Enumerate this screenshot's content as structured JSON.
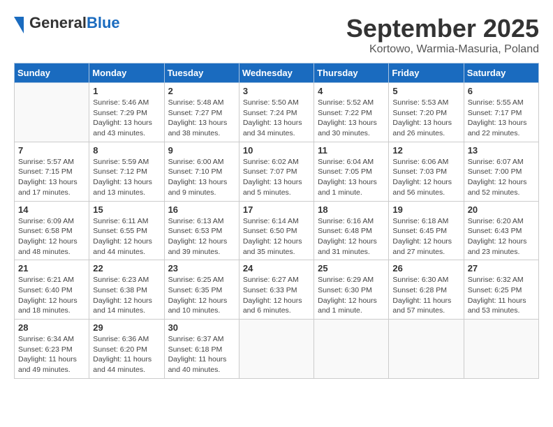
{
  "header": {
    "logo_general": "General",
    "logo_blue": "Blue",
    "month_title": "September 2025",
    "location": "Kortowo, Warmia-Masuria, Poland"
  },
  "days_of_week": [
    "Sunday",
    "Monday",
    "Tuesday",
    "Wednesday",
    "Thursday",
    "Friday",
    "Saturday"
  ],
  "weeks": [
    [
      {
        "day": "",
        "info": ""
      },
      {
        "day": "1",
        "info": "Sunrise: 5:46 AM\nSunset: 7:29 PM\nDaylight: 13 hours\nand 43 minutes."
      },
      {
        "day": "2",
        "info": "Sunrise: 5:48 AM\nSunset: 7:27 PM\nDaylight: 13 hours\nand 38 minutes."
      },
      {
        "day": "3",
        "info": "Sunrise: 5:50 AM\nSunset: 7:24 PM\nDaylight: 13 hours\nand 34 minutes."
      },
      {
        "day": "4",
        "info": "Sunrise: 5:52 AM\nSunset: 7:22 PM\nDaylight: 13 hours\nand 30 minutes."
      },
      {
        "day": "5",
        "info": "Sunrise: 5:53 AM\nSunset: 7:20 PM\nDaylight: 13 hours\nand 26 minutes."
      },
      {
        "day": "6",
        "info": "Sunrise: 5:55 AM\nSunset: 7:17 PM\nDaylight: 13 hours\nand 22 minutes."
      }
    ],
    [
      {
        "day": "7",
        "info": "Sunrise: 5:57 AM\nSunset: 7:15 PM\nDaylight: 13 hours\nand 17 minutes."
      },
      {
        "day": "8",
        "info": "Sunrise: 5:59 AM\nSunset: 7:12 PM\nDaylight: 13 hours\nand 13 minutes."
      },
      {
        "day": "9",
        "info": "Sunrise: 6:00 AM\nSunset: 7:10 PM\nDaylight: 13 hours\nand 9 minutes."
      },
      {
        "day": "10",
        "info": "Sunrise: 6:02 AM\nSunset: 7:07 PM\nDaylight: 13 hours\nand 5 minutes."
      },
      {
        "day": "11",
        "info": "Sunrise: 6:04 AM\nSunset: 7:05 PM\nDaylight: 13 hours\nand 1 minute."
      },
      {
        "day": "12",
        "info": "Sunrise: 6:06 AM\nSunset: 7:03 PM\nDaylight: 12 hours\nand 56 minutes."
      },
      {
        "day": "13",
        "info": "Sunrise: 6:07 AM\nSunset: 7:00 PM\nDaylight: 12 hours\nand 52 minutes."
      }
    ],
    [
      {
        "day": "14",
        "info": "Sunrise: 6:09 AM\nSunset: 6:58 PM\nDaylight: 12 hours\nand 48 minutes."
      },
      {
        "day": "15",
        "info": "Sunrise: 6:11 AM\nSunset: 6:55 PM\nDaylight: 12 hours\nand 44 minutes."
      },
      {
        "day": "16",
        "info": "Sunrise: 6:13 AM\nSunset: 6:53 PM\nDaylight: 12 hours\nand 39 minutes."
      },
      {
        "day": "17",
        "info": "Sunrise: 6:14 AM\nSunset: 6:50 PM\nDaylight: 12 hours\nand 35 minutes."
      },
      {
        "day": "18",
        "info": "Sunrise: 6:16 AM\nSunset: 6:48 PM\nDaylight: 12 hours\nand 31 minutes."
      },
      {
        "day": "19",
        "info": "Sunrise: 6:18 AM\nSunset: 6:45 PM\nDaylight: 12 hours\nand 27 minutes."
      },
      {
        "day": "20",
        "info": "Sunrise: 6:20 AM\nSunset: 6:43 PM\nDaylight: 12 hours\nand 23 minutes."
      }
    ],
    [
      {
        "day": "21",
        "info": "Sunrise: 6:21 AM\nSunset: 6:40 PM\nDaylight: 12 hours\nand 18 minutes."
      },
      {
        "day": "22",
        "info": "Sunrise: 6:23 AM\nSunset: 6:38 PM\nDaylight: 12 hours\nand 14 minutes."
      },
      {
        "day": "23",
        "info": "Sunrise: 6:25 AM\nSunset: 6:35 PM\nDaylight: 12 hours\nand 10 minutes."
      },
      {
        "day": "24",
        "info": "Sunrise: 6:27 AM\nSunset: 6:33 PM\nDaylight: 12 hours\nand 6 minutes."
      },
      {
        "day": "25",
        "info": "Sunrise: 6:29 AM\nSunset: 6:30 PM\nDaylight: 12 hours\nand 1 minute."
      },
      {
        "day": "26",
        "info": "Sunrise: 6:30 AM\nSunset: 6:28 PM\nDaylight: 11 hours\nand 57 minutes."
      },
      {
        "day": "27",
        "info": "Sunrise: 6:32 AM\nSunset: 6:25 PM\nDaylight: 11 hours\nand 53 minutes."
      }
    ],
    [
      {
        "day": "28",
        "info": "Sunrise: 6:34 AM\nSunset: 6:23 PM\nDaylight: 11 hours\nand 49 minutes."
      },
      {
        "day": "29",
        "info": "Sunrise: 6:36 AM\nSunset: 6:20 PM\nDaylight: 11 hours\nand 44 minutes."
      },
      {
        "day": "30",
        "info": "Sunrise: 6:37 AM\nSunset: 6:18 PM\nDaylight: 11 hours\nand 40 minutes."
      },
      {
        "day": "",
        "info": ""
      },
      {
        "day": "",
        "info": ""
      },
      {
        "day": "",
        "info": ""
      },
      {
        "day": "",
        "info": ""
      }
    ]
  ]
}
